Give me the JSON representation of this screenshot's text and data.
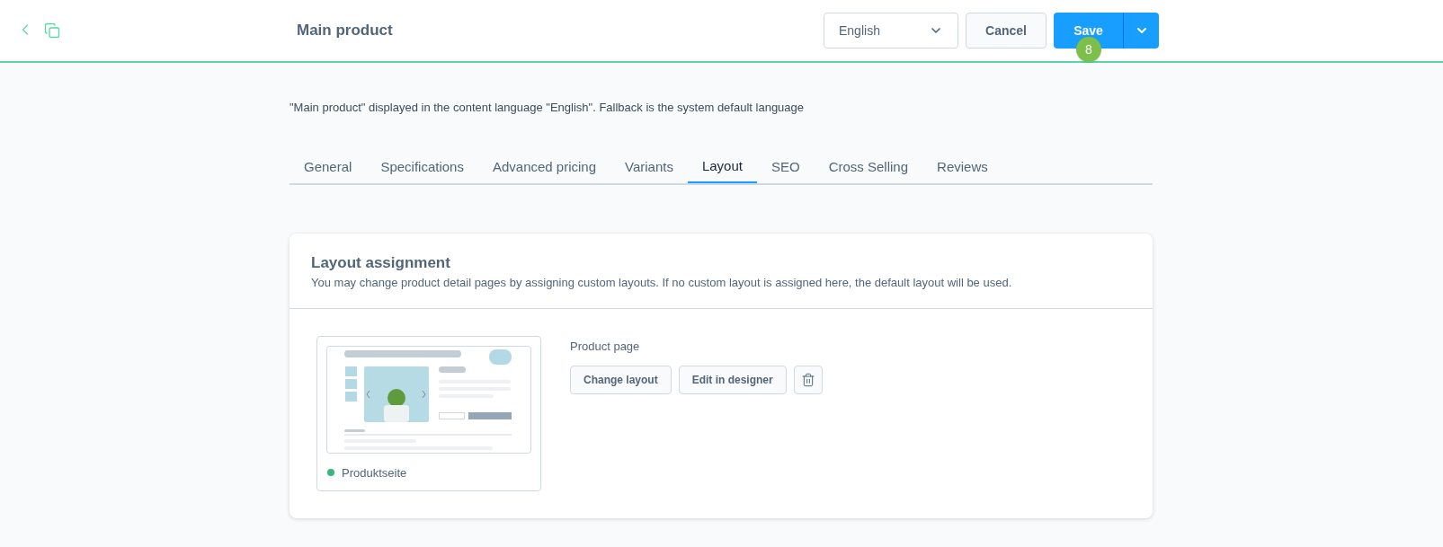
{
  "header": {
    "title": "Main product",
    "language": "English",
    "cancel": "Cancel",
    "save": "Save",
    "badge": "8"
  },
  "info": "\"Main product\" displayed in the content language \"English\". Fallback is the system default language",
  "tabs": [
    {
      "label": "General",
      "selected": false
    },
    {
      "label": "Specifications",
      "selected": false
    },
    {
      "label": "Advanced pricing",
      "selected": false
    },
    {
      "label": "Variants",
      "selected": false
    },
    {
      "label": "Layout",
      "selected": true
    },
    {
      "label": "SEO",
      "selected": false
    },
    {
      "label": "Cross Selling",
      "selected": false
    },
    {
      "label": "Reviews",
      "selected": false
    }
  ],
  "card": {
    "title": "Layout assignment",
    "subtitle": "You may change product detail pages by assigning custom layouts. If no custom layout is assigned here, the default layout will be used.",
    "layout": {
      "name": "Produktseite",
      "color": "#37b77a"
    },
    "label": "Product page",
    "buttons": [
      "Change layout",
      "Edit in designer"
    ]
  }
}
